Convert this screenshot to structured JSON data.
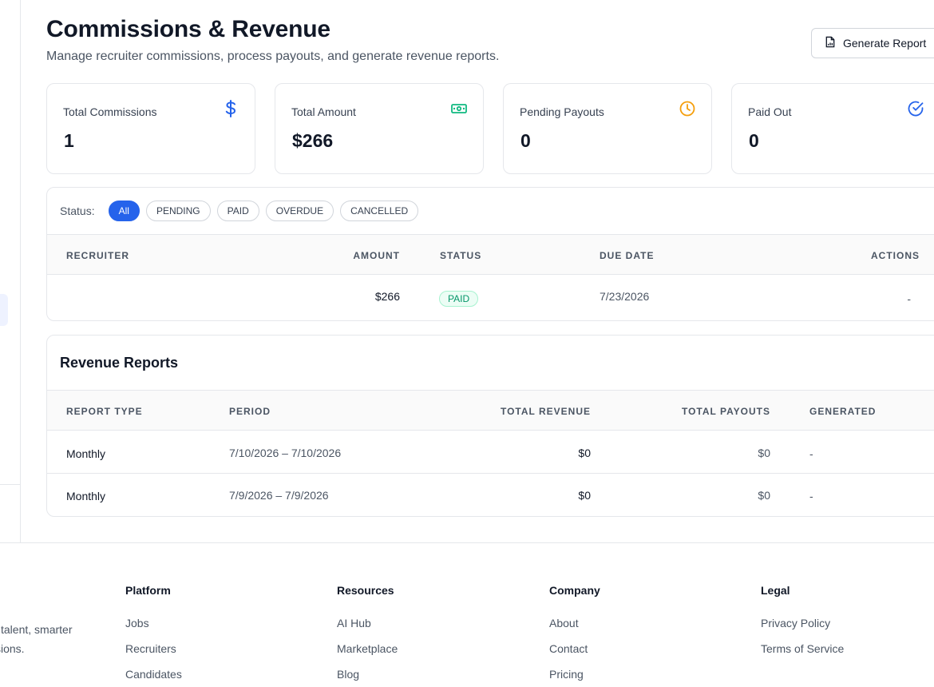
{
  "header": {
    "title": "Commissions & Revenue",
    "subtitle": "Manage recruiter commissions, process payouts, and generate revenue reports.",
    "generate_report_label": "Generate Report"
  },
  "stats": [
    {
      "label": "Total Commissions",
      "value": "1",
      "icon": "dollar-icon",
      "color": "#2563eb"
    },
    {
      "label": "Total Amount",
      "value": "$266",
      "icon": "banknote-icon",
      "color": "#10b981"
    },
    {
      "label": "Pending Payouts",
      "value": "0",
      "icon": "clock-icon",
      "color": "#f59e0b"
    },
    {
      "label": "Paid Out",
      "value": "0",
      "icon": "check-circle-icon",
      "color": "#2563eb"
    }
  ],
  "filters": {
    "label": "Status:",
    "options": [
      "All",
      "PENDING",
      "PAID",
      "OVERDUE",
      "CANCELLED"
    ],
    "selected": "All"
  },
  "commissions_table": {
    "columns": [
      "RECRUITER",
      "AMOUNT",
      "STATUS",
      "DUE DATE",
      "ACTIONS"
    ],
    "rows": [
      {
        "recruiter": "",
        "amount": "$266",
        "status": "PAID",
        "due_date": "7/23/2026",
        "actions": "-"
      }
    ]
  },
  "reports": {
    "title": "Revenue Reports",
    "columns": [
      "REPORT TYPE",
      "PERIOD",
      "TOTAL REVENUE",
      "TOTAL PAYOUTS",
      "GENERATED"
    ],
    "rows": [
      {
        "type": "Monthly",
        "period": "7/10/2026 – 7/10/2026",
        "revenue": "$0",
        "payouts": "$0",
        "generated": "-"
      },
      {
        "type": "Monthly",
        "period": "7/9/2026 – 7/9/2026",
        "revenue": "$0",
        "payouts": "$0",
        "generated": "-"
      }
    ]
  },
  "footer": {
    "brand_text": "l talent, smarter sions.",
    "columns": [
      {
        "title": "Platform",
        "links": [
          "Jobs",
          "Recruiters",
          "Candidates"
        ]
      },
      {
        "title": "Resources",
        "links": [
          "AI Hub",
          "Marketplace",
          "Blog"
        ]
      },
      {
        "title": "Company",
        "links": [
          "About",
          "Contact",
          "Pricing"
        ]
      },
      {
        "title": "Legal",
        "links": [
          "Privacy Policy",
          "Terms of Service"
        ]
      }
    ]
  },
  "colors": {
    "accent": "#2563eb",
    "paid_badge": "#059669"
  }
}
